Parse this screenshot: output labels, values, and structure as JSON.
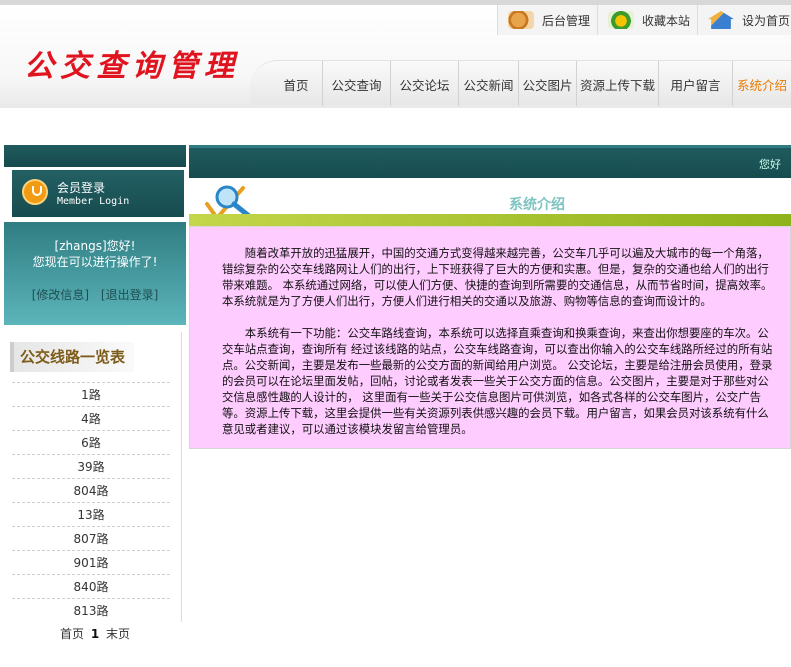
{
  "site": {
    "logo_text": "公交查询管理"
  },
  "quick_links": [
    {
      "label": "后台管理",
      "icon": "admin-icon"
    },
    {
      "label": "收藏本站",
      "icon": "favorite-icon"
    },
    {
      "label": "设为首页",
      "icon": "home-icon"
    }
  ],
  "nav": [
    {
      "label": "首页"
    },
    {
      "label": "公交查询"
    },
    {
      "label": "公交论坛"
    },
    {
      "label": "公交新闻"
    },
    {
      "label": "公交图片"
    },
    {
      "label": "资源上传下载"
    },
    {
      "label": "用户留言"
    },
    {
      "label": "系统介绍",
      "active": true
    }
  ],
  "login": {
    "title": "会员登录",
    "subtitle": "Member Login",
    "greeting_line1": "[zhangs]您好!",
    "greeting_line2": "您现在可以进行操作了!",
    "edit_link": "[修改信息]",
    "logout_link": "[退出登录]"
  },
  "routes": {
    "title": "公交线路一览表",
    "items": [
      "1路",
      "4路",
      "6路",
      "39路",
      "804路",
      "13路",
      "807路",
      "901路",
      "840路",
      "813路"
    ],
    "pager": {
      "first": "首页",
      "current": "1",
      "last": "末页"
    }
  },
  "header_bar": {
    "hello": "您好"
  },
  "section": {
    "title": "系统介绍",
    "paragraph1": "随着改革开放的迅猛展开，中国的交通方式变得越来越完善，公交车几乎可以遍及大城市的每一个角落，  错综复杂的公交车线路网让人们的出行，上下班获得了巨大的方便和实惠。但是，复杂的交通也给人们的出行带来难题。  本系统通过网络，可以使人们方便、快捷的查询到所需要的交通信息，从而节省时间，提高效率。  本系统就是为了方便人们出行，方便人们进行相关的交通以及旅游、购物等信息的查询而设计的。",
    "paragraph2": "本系统有一下功能：公交车路线查询，本系统可以选择直乘查询和换乘查询，来查出你想要座的车次。公交车站点查询，查询所有  经过该线路的站点，公交车线路查询，可以查出你输入的公交车线路所经过的所有站点。公交新闻，主要是发布一些最新的公交方面的新闻给用户浏览。  公交论坛，主要是给注册会员使用，登录的会员可以在论坛里面发帖，回帖，讨论或者发表一些关于公交方面的信息。公交图片，主要是对于那些对公交信息感性趣的人设计的，  这里面有一些关于公交信息图片可供浏览，如各式各样的公交车图片，公交广告等。资源上传下载，这里会提供一些有关资源列表供感兴趣的会员下载。用户留言，如果会员对该系统有什么意见或者建议，可以通过该模块发留言给管理员。"
  },
  "colors": {
    "logo": "#e0141e",
    "teal": "#1f5b5e",
    "content_bg": "#ffccff",
    "green_bar": "#8fb21a",
    "nav_active": "#e87a00"
  }
}
